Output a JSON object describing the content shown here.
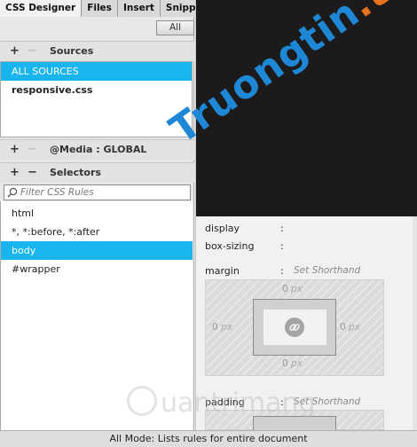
{
  "tabs": [
    {
      "label": "CSS Designer",
      "active": true
    },
    {
      "label": "Files",
      "active": false
    },
    {
      "label": "Insert",
      "active": false
    },
    {
      "label": "Snippets",
      "active": false
    }
  ],
  "all_button": "All",
  "sources": {
    "title": "Sources",
    "items": [
      "ALL SOURCES",
      "responsive.css"
    ],
    "selected": "ALL SOURCES"
  },
  "media": {
    "title": "@Media :  GLOBAL"
  },
  "selectors": {
    "title": "Selectors",
    "filter_placeholder": "Filter CSS Rules",
    "items": [
      "html",
      "*, *:before, *:after",
      "body",
      "#wrapper"
    ],
    "selected": "body"
  },
  "properties": {
    "display": {
      "label": "display",
      "colon": ":"
    },
    "box_sizing": {
      "label": "box-sizing",
      "colon": ":"
    },
    "margin": {
      "label": "margin",
      "colon": ":",
      "shorthand": "Set Shorthand"
    },
    "padding": {
      "label": "padding",
      "colon": ":",
      "shorthand": "Set Shorthand"
    }
  },
  "box_model": {
    "top": "0",
    "right": "0",
    "bottom": "0",
    "left": "0",
    "unit": "px"
  },
  "watermarks": {
    "main": "Truongtin",
    "main_suffix": ".top",
    "secondary": "uantrimang"
  },
  "status_bar": "All Mode: Lists rules for entire document",
  "colors": {
    "selection": "#19b5ee",
    "watermark_blue": "#1e88d6",
    "watermark_orange": "#e8711d"
  }
}
